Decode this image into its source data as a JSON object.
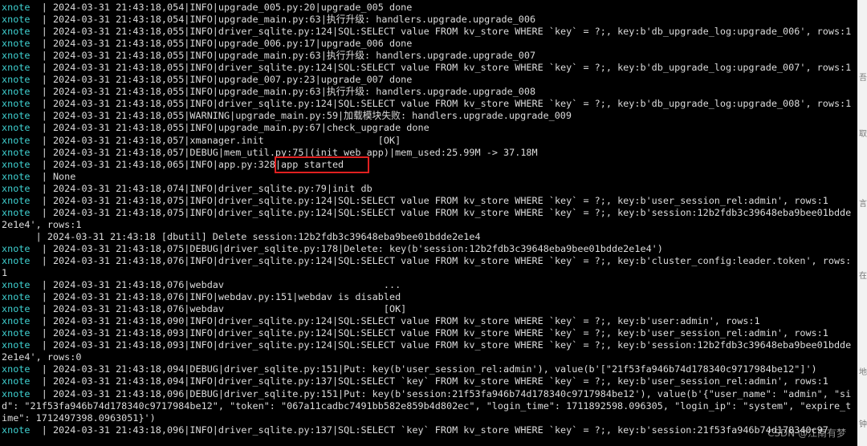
{
  "terminal": {
    "lines": [
      {
        "prefix": "xnote",
        "text": "| 2024-03-31 21:43:18,054|INFO|upgrade_005.py:20|upgrade_005 done"
      },
      {
        "prefix": "xnote",
        "text": "| 2024-03-31 21:43:18,054|INFO|upgrade_main.py:63|执行升级: handlers.upgrade.upgrade_006"
      },
      {
        "prefix": "xnote",
        "text": "| 2024-03-31 21:43:18,055|INFO|driver_sqlite.py:124|SQL:SELECT value FROM kv_store WHERE `key` = ?;, key:b'db_upgrade_log:upgrade_006', rows:1"
      },
      {
        "prefix": "xnote",
        "text": "| 2024-03-31 21:43:18,055|INFO|upgrade_006.py:17|upgrade_006 done"
      },
      {
        "prefix": "xnote",
        "text": "| 2024-03-31 21:43:18,055|INFO|upgrade_main.py:63|执行升级: handlers.upgrade.upgrade_007"
      },
      {
        "prefix": "xnote",
        "text": "| 2024-03-31 21:43:18,055|INFO|driver_sqlite.py:124|SQL:SELECT value FROM kv_store WHERE `key` = ?;, key:b'db_upgrade_log:upgrade_007', rows:1"
      },
      {
        "prefix": "xnote",
        "text": "| 2024-03-31 21:43:18,055|INFO|upgrade_007.py:23|upgrade_007 done"
      },
      {
        "prefix": "xnote",
        "text": "| 2024-03-31 21:43:18,055|INFO|upgrade_main.py:63|执行升级: handlers.upgrade.upgrade_008"
      },
      {
        "prefix": "xnote",
        "text": "| 2024-03-31 21:43:18,055|INFO|driver_sqlite.py:124|SQL:SELECT value FROM kv_store WHERE `key` = ?;, key:b'db_upgrade_log:upgrade_008', rows:1"
      },
      {
        "prefix": "xnote",
        "text": "| 2024-03-31 21:43:18,055|WARNING|upgrade_main.py:59|加载模块失败: handlers.upgrade.upgrade_009"
      },
      {
        "prefix": "xnote",
        "text": "| 2024-03-31 21:43:18,055|INFO|upgrade_main.py:67|check_upgrade done"
      },
      {
        "prefix": "xnote",
        "text": "| 2024-03-31 21:43:18,057|xmanager.init                    [OK]"
      },
      {
        "prefix": "xnote",
        "text": "| 2024-03-31 21:43:18,057|DEBUG|mem_util.py:75|(init_web_app)|mem_used:25.99M -> 37.18M"
      },
      {
        "prefix": "xnote",
        "text": "| 2024-03-31 21:43:18,065|INFO|app.py:328|app started"
      },
      {
        "prefix": "xnote",
        "text": "| None"
      },
      {
        "prefix": "xnote",
        "text": "| 2024-03-31 21:43:18,074|INFO|driver_sqlite.py:79|init db"
      },
      {
        "prefix": "xnote",
        "text": "| 2024-03-31 21:43:18,075|INFO|driver_sqlite.py:124|SQL:SELECT value FROM kv_store WHERE `key` = ?;, key:b'user_session_rel:admin', rows:1"
      },
      {
        "prefix": "xnote",
        "text": "| 2024-03-31 21:43:18,075|INFO|driver_sqlite.py:124|SQL:SELECT value FROM kv_store WHERE `key` = ?;, key:b'session:12b2fdb3c39648eba9bee01bdde"
      },
      {
        "prefix": "",
        "text": "2e1e4', rows:1"
      },
      {
        "prefix": "",
        "text": "      | 2024-03-31 21:43:18 [dbutil] Delete session:12b2fdb3c39648eba9bee01bdde2e1e4"
      },
      {
        "prefix": "xnote",
        "text": "| 2024-03-31 21:43:18,075|DEBUG|driver_sqlite.py:178|Delete: key(b'session:12b2fdb3c39648eba9bee01bdde2e1e4')"
      },
      {
        "prefix": "xnote",
        "text": "| 2024-03-31 21:43:18,076|INFO|driver_sqlite.py:124|SQL:SELECT value FROM kv_store WHERE `key` = ?;, key:b'cluster_config:leader.token', rows:"
      },
      {
        "prefix": "",
        "text": "1"
      },
      {
        "prefix": "xnote",
        "text": "| 2024-03-31 21:43:18,076|webdav                            ..."
      },
      {
        "prefix": "xnote",
        "text": "| 2024-03-31 21:43:18,076|INFO|webdav.py:151|webdav is disabled"
      },
      {
        "prefix": "xnote",
        "text": "| 2024-03-31 21:43:18,076|webdav                            [OK]"
      },
      {
        "prefix": "xnote",
        "text": "| 2024-03-31 21:43:18,090|INFO|driver_sqlite.py:124|SQL:SELECT value FROM kv_store WHERE `key` = ?;, key:b'user:admin', rows:1"
      },
      {
        "prefix": "xnote",
        "text": "| 2024-03-31 21:43:18,093|INFO|driver_sqlite.py:124|SQL:SELECT value FROM kv_store WHERE `key` = ?;, key:b'user_session_rel:admin', rows:1"
      },
      {
        "prefix": "xnote",
        "text": "| 2024-03-31 21:43:18,093|INFO|driver_sqlite.py:124|SQL:SELECT value FROM kv_store WHERE `key` = ?;, key:b'session:12b2fdb3c39648eba9bee01bdde"
      },
      {
        "prefix": "",
        "text": "2e1e4', rows:0"
      },
      {
        "prefix": "xnote",
        "text": "| 2024-03-31 21:43:18,094|DEBUG|driver_sqlite.py:151|Put: key(b'user_session_rel:admin'), value(b'[\"21f53fa946b74d178340c9717984be12\"]')"
      },
      {
        "prefix": "xnote",
        "text": "| 2024-03-31 21:43:18,094|INFO|driver_sqlite.py:137|SQL:SELECT `key` FROM kv_store WHERE `key` = ?;, key:b'user_session_rel:admin', rows:1"
      },
      {
        "prefix": "xnote",
        "text": "| 2024-03-31 21:43:18,096|DEBUG|driver_sqlite.py:151|Put: key(b'session:21f53fa946b74d178340c9717984be12'), value(b'{\"user_name\": \"admin\", \"si"
      },
      {
        "prefix": "",
        "text": "d\": \"21f53fa946b74d178340c9717984be12\", \"token\": \"067a11cadbc7491bb582e859b4d802ec\", \"login_time\": 1711892598.096305, \"login_ip\": \"system\", \"expire_t"
      },
      {
        "prefix": "",
        "text": "ime\": 1712497398.0963051}')"
      },
      {
        "prefix": "xnote",
        "text": "| 2024-03-31 21:43:18,096|INFO|driver_sqlite.py:137|SQL:SELECT `key` FROM kv_store WHERE `key` = ?;, key:b'session:21f53fa946b74d178340c97"
      }
    ]
  },
  "highlight": {
    "label": "app started"
  },
  "watermark": "CSDN @江南有梦",
  "right_edge_glyphs": [
    "吾",
    "取",
    "言",
    "在",
    "地",
    "钟"
  ]
}
